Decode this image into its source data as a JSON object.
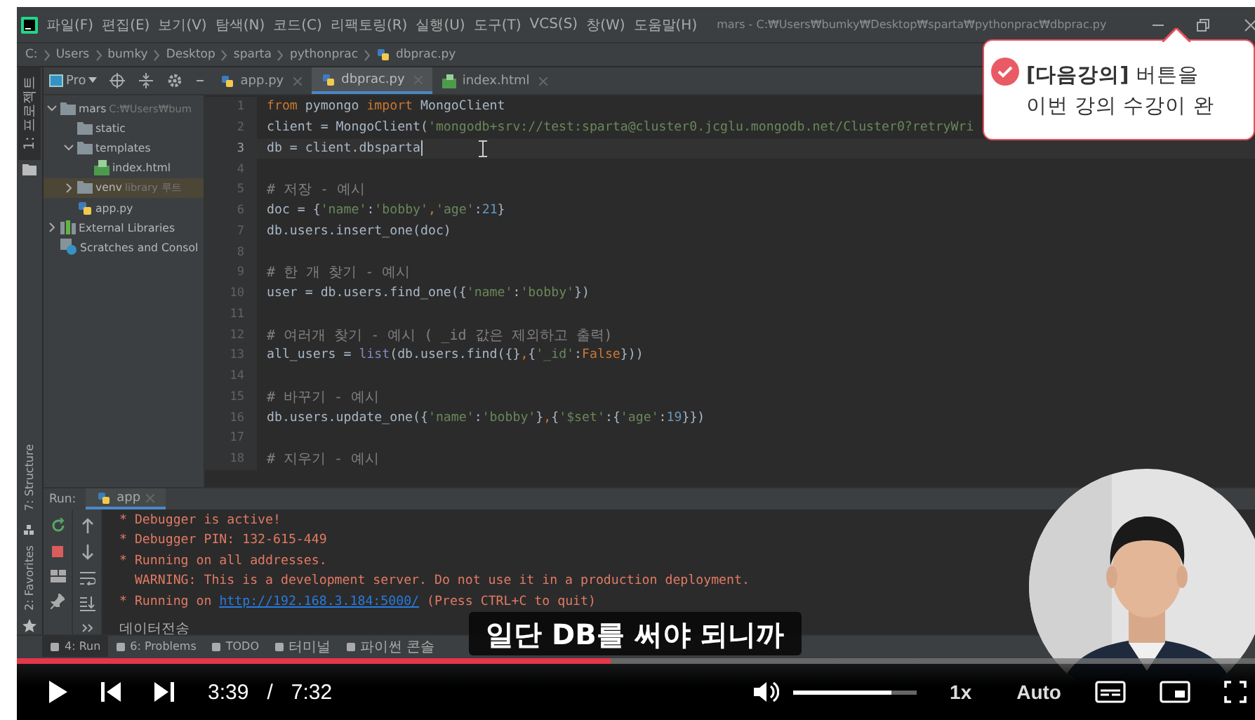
{
  "window": {
    "title": "mars - C:₩Users₩bumky₩Desktop₩sparta₩pythonprac₩dbprac.py"
  },
  "menu": [
    "파일(F)",
    "편집(E)",
    "보기(V)",
    "탐색(N)",
    "코드(C)",
    "리팩토링(R)",
    "실행(U)",
    "도구(T)",
    "VCS(S)",
    "창(W)",
    "도움말(H)"
  ],
  "breadcrumb": [
    "C:",
    "Users",
    "bumky",
    "Desktop",
    "sparta",
    "pythonprac",
    "dbprac.py"
  ],
  "tool_stripe": [
    {
      "label": "1: 프로젝트",
      "selected": true
    },
    {
      "label": "7: Structure",
      "selected": false
    },
    {
      "label": "2: Favorites",
      "selected": false
    }
  ],
  "project": {
    "selector": "Pro",
    "tree": [
      {
        "name": "mars",
        "note": "C:₩Users₩bum",
        "kind": "folder",
        "expanded": true,
        "selected": false,
        "children": [
          {
            "name": "static",
            "kind": "folder",
            "selected": false
          },
          {
            "name": "templates",
            "kind": "folder",
            "expanded": true,
            "selected": false,
            "children": [
              {
                "name": "index.html",
                "kind": "html",
                "selected": false
              }
            ]
          },
          {
            "name": "venv",
            "note": "library 루트",
            "kind": "folder",
            "expanded": false,
            "selected": true
          },
          {
            "name": "app.py",
            "kind": "python",
            "selected": false
          }
        ]
      },
      {
        "name": "External Libraries",
        "kind": "library",
        "expanded": false,
        "selected": false
      },
      {
        "name": "Scratches and Consol",
        "kind": "scratches",
        "selected": false
      }
    ]
  },
  "tabs": [
    {
      "label": "app.py",
      "kind": "python",
      "selected": false
    },
    {
      "label": "dbprac.py",
      "kind": "python",
      "selected": true
    },
    {
      "label": "index.html",
      "kind": "html",
      "selected": false
    }
  ],
  "editor": {
    "lines": [
      {
        "number": "1",
        "current": false,
        "tokens": [
          {
            "kind": "keyword",
            "text": "from"
          },
          {
            "kind": "plain",
            "text": " pymongo "
          },
          {
            "kind": "keyword",
            "text": "import"
          },
          {
            "kind": "plain",
            "text": " MongoClient"
          }
        ]
      },
      {
        "number": "2",
        "current": false,
        "tokens": [
          {
            "kind": "plain",
            "text": "client = MongoClient("
          },
          {
            "kind": "string",
            "text": "'mongodb+srv://test:sparta@cluster0.jcglu.mongodb.net/Cluster0?retryWri"
          }
        ]
      },
      {
        "number": "3",
        "current": true,
        "tokens": [
          {
            "kind": "plain",
            "text": "db = client.dbsparta"
          }
        ]
      },
      {
        "number": "4",
        "current": false
      },
      {
        "number": "5",
        "current": false,
        "tokens": [
          {
            "kind": "comment",
            "text": "# 저장 - 예시"
          }
        ]
      },
      {
        "number": "6",
        "current": false,
        "tokens": [
          {
            "kind": "plain",
            "text": "doc = {"
          },
          {
            "kind": "string",
            "text": "'name'"
          },
          {
            "kind": "plain",
            "text": ":"
          },
          {
            "kind": "string",
            "text": "'bobby'"
          },
          {
            "kind": "keyword",
            "text": ","
          },
          {
            "kind": "string",
            "text": "'age'"
          },
          {
            "kind": "plain",
            "text": ":"
          },
          {
            "kind": "number",
            "text": "21"
          },
          {
            "kind": "plain",
            "text": "}"
          }
        ]
      },
      {
        "number": "7",
        "current": false,
        "tokens": [
          {
            "kind": "plain",
            "text": "db.users.insert_one(doc)"
          }
        ]
      },
      {
        "number": "8",
        "current": false
      },
      {
        "number": "9",
        "current": false,
        "tokens": [
          {
            "kind": "comment",
            "text": "# 한 개 찾기 - 예시"
          }
        ]
      },
      {
        "number": "10",
        "current": false,
        "tokens": [
          {
            "kind": "plain",
            "text": "user = db.users.find_one({"
          },
          {
            "kind": "string",
            "text": "'name'"
          },
          {
            "kind": "plain",
            "text": ":"
          },
          {
            "kind": "string",
            "text": "'bobby'"
          },
          {
            "kind": "plain",
            "text": "})"
          }
        ]
      },
      {
        "number": "11",
        "current": false
      },
      {
        "number": "12",
        "current": false,
        "tokens": [
          {
            "kind": "comment",
            "text": "# 여러개 찾기 - 예시 ( _id 값은 제외하고 출력)"
          }
        ]
      },
      {
        "number": "13",
        "current": false,
        "tokens": [
          {
            "kind": "plain",
            "text": "all_users = "
          },
          {
            "kind": "builtin",
            "text": "list"
          },
          {
            "kind": "plain",
            "text": "(db.users.find({}"
          },
          {
            "kind": "keyword",
            "text": ","
          },
          {
            "kind": "plain",
            "text": "{"
          },
          {
            "kind": "string",
            "text": "'_id'"
          },
          {
            "kind": "plain",
            "text": ":"
          },
          {
            "kind": "keyword",
            "text": "False"
          },
          {
            "kind": "plain",
            "text": "}))"
          }
        ]
      },
      {
        "number": "14",
        "current": false
      },
      {
        "number": "15",
        "current": false,
        "tokens": [
          {
            "kind": "comment",
            "text": "# 바꾸기 - 예시"
          }
        ]
      },
      {
        "number": "16",
        "current": false,
        "tokens": [
          {
            "kind": "plain",
            "text": "db.users.update_one({"
          },
          {
            "kind": "string",
            "text": "'name'"
          },
          {
            "kind": "plain",
            "text": ":"
          },
          {
            "kind": "string",
            "text": "'bobby'"
          },
          {
            "kind": "plain",
            "text": "}"
          },
          {
            "kind": "keyword",
            "text": ","
          },
          {
            "kind": "plain",
            "text": "{"
          },
          {
            "kind": "string",
            "text": "'$set'"
          },
          {
            "kind": "plain",
            "text": ":{"
          },
          {
            "kind": "string",
            "text": "'age'"
          },
          {
            "kind": "plain",
            "text": ":"
          },
          {
            "kind": "number",
            "text": "19"
          },
          {
            "kind": "plain",
            "text": "}})"
          }
        ]
      },
      {
        "number": "17",
        "current": false
      },
      {
        "number": "18",
        "current": false,
        "tokens": [
          {
            "kind": "comment",
            "text": "# 지우기 - 예시"
          }
        ]
      }
    ]
  },
  "run": {
    "label": "Run:",
    "tab": "app",
    "output": [
      {
        "kind": "log",
        "text": "* Debugger is active!"
      },
      {
        "kind": "log",
        "text": "* Debugger PIN: 132-615-449"
      },
      {
        "kind": "log",
        "text": "* Running on all addresses."
      },
      {
        "kind": "log",
        "text": "  WARNING: This is a development server. Do not use it in a production deployment."
      },
      {
        "kind": "link-line",
        "text": "* Running on ",
        "link": "http://192.168.3.184:5000/",
        "after": " (Press CTRL+C to quit)"
      }
    ],
    "input": "데이터전송"
  },
  "tool_tabs": [
    {
      "label": "4: Run",
      "selected": true
    },
    {
      "label": "6: Problems",
      "selected": false
    },
    {
      "label": "TODO",
      "selected": false
    },
    {
      "label": "터미널",
      "selected": false
    },
    {
      "label": "파이썬 콘솔",
      "selected": false
    }
  ],
  "popup": {
    "lines": [
      "**[다음강의]** 버튼을",
      "이번 강의 수강이 완"
    ]
  },
  "subtitle": "일단 DB를 써야 되니까",
  "player": {
    "playing": false,
    "current_time": "3:39",
    "separator": "/",
    "duration": "7:32",
    "progress": {
      "level": 0.48
    },
    "volume": {
      "level": 0.8
    },
    "speed": "1x",
    "quality": "Auto"
  }
}
